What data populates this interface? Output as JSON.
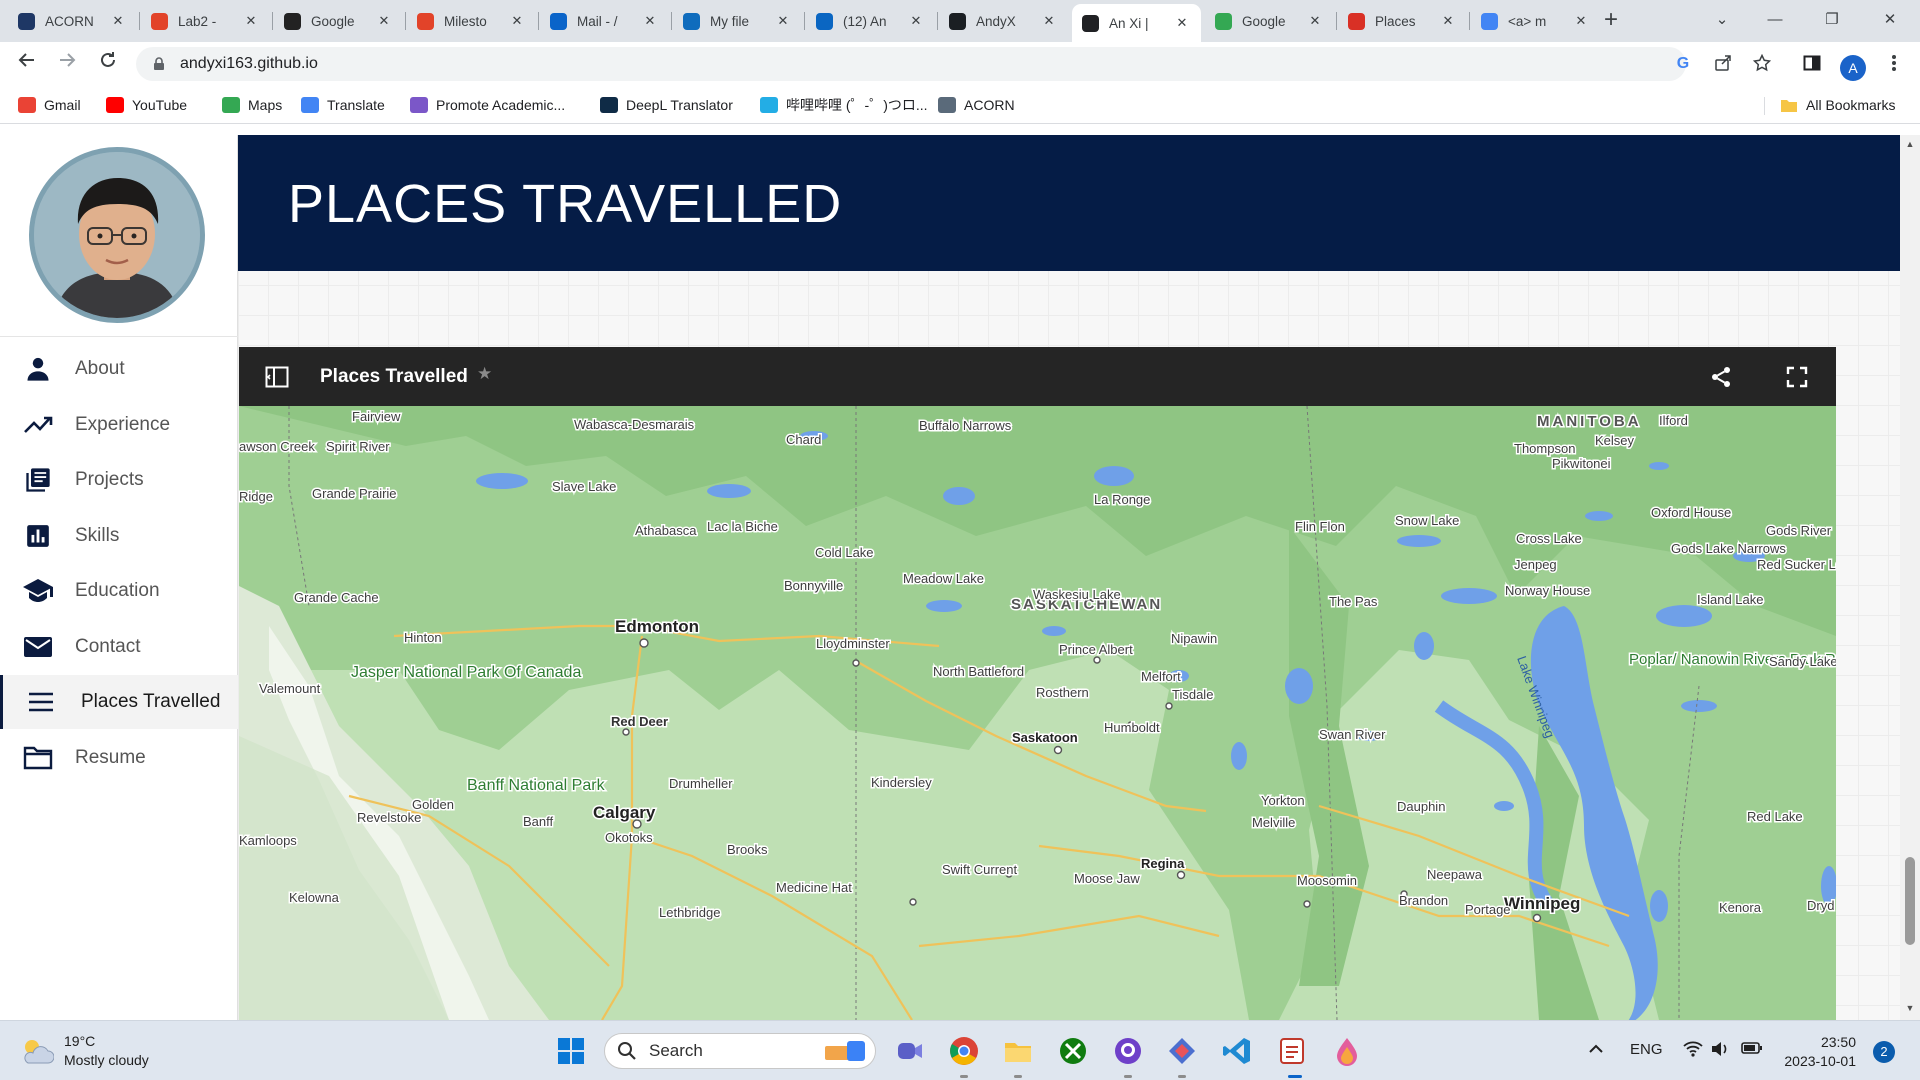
{
  "browser": {
    "tabs": [
      {
        "label": "ACORN",
        "icon": "acorn-icon",
        "color": "#1e3765"
      },
      {
        "label": "Lab2 -",
        "icon": "gitlab-icon",
        "color": "#e24329"
      },
      {
        "label": "Google",
        "icon": "google-meet-icon",
        "color": "#222222"
      },
      {
        "label": "Milesto",
        "icon": "gitlab-icon",
        "color": "#e24329"
      },
      {
        "label": "Mail - /",
        "icon": "outlook-icon",
        "color": "#0a64c9"
      },
      {
        "label": "My file",
        "icon": "onedrive-icon",
        "color": "#0f6cbd"
      },
      {
        "label": "(12) An",
        "icon": "linkedin-icon",
        "color": "#0a66c2"
      },
      {
        "label": "AndyX",
        "icon": "github-icon",
        "color": "#1b1f23"
      },
      {
        "label": "An Xi |",
        "icon": "code-icon",
        "color": "#202124"
      },
      {
        "label": "Google",
        "icon": "google-maps-icon",
        "color": "#34a853"
      },
      {
        "label": "Places",
        "icon": "places-icon",
        "color": "#d93025"
      },
      {
        "label": "<a> m",
        "icon": "google-icon",
        "color": "#4285f4"
      }
    ],
    "active_tab": 8,
    "url": "andyxi163.github.io",
    "profile_initial": "A",
    "bookmarks": [
      {
        "label": "Gmail",
        "color": "#ea4335"
      },
      {
        "label": "YouTube",
        "color": "#ff0000"
      },
      {
        "label": "Maps",
        "color": "#34a853"
      },
      {
        "label": "Translate",
        "color": "#4285f4"
      },
      {
        "label": "Promote Academic...",
        "color": "#7b57c8"
      },
      {
        "label": "DeepL Translator",
        "color": "#0f2b46"
      },
      {
        "label": "哔哩哔哩 (゜-゜)つロ...",
        "color": "#23ade5"
      },
      {
        "label": "ACORN",
        "color": "#5a6a7a"
      }
    ],
    "all_bookmarks": "All Bookmarks"
  },
  "sidebar": {
    "items": [
      {
        "label": "About",
        "icon": "person-icon"
      },
      {
        "label": "Experience",
        "icon": "trending-up-icon"
      },
      {
        "label": "Projects",
        "icon": "library-books-icon"
      },
      {
        "label": "Skills",
        "icon": "bar-chart-icon"
      },
      {
        "label": "Education",
        "icon": "school-icon"
      },
      {
        "label": "Contact",
        "icon": "mail-icon"
      },
      {
        "label": "Places Travelled",
        "icon": "menu-icon"
      },
      {
        "label": "Resume",
        "icon": "folder-icon"
      }
    ],
    "active_item": 6
  },
  "banner": {
    "title": "PLACES TRAVELLED"
  },
  "map": {
    "title": "Places Travelled",
    "labels": {
      "manitoba": "MANITOBA",
      "saskatchewan": "SASKATCHEWAN",
      "edmonton": "Edmonton",
      "calgary": "Calgary",
      "saskatoon": "Saskatoon",
      "regina": "Regina",
      "winnipeg": "Winnipeg",
      "fairview": "Fairview",
      "dawson_creek": "awson Creek",
      "spirit_river": "Spirit River",
      "wabasca": "Wabasca-Desmarais",
      "chard": "Chard",
      "buffalo_narrows": "Buffalo Narrows",
      "thompson": "Thompson",
      "kelsey": "Kelsey",
      "ilford": "Ilford",
      "pikwitonei": "Pikwitonei",
      "ridge": "Ridge",
      "grande_prairie": "Grande Prairie",
      "slave_lake": "Slave Lake",
      "la_ronge": "La Ronge",
      "oxford_house": "Oxford House",
      "athabasca": "Athabasca",
      "lac_la_biche": "Lac la Biche",
      "flin_flon": "Flin Flon",
      "snow_lake": "Snow Lake",
      "gods_river": "Gods River",
      "cold_lake": "Cold Lake",
      "cross_lake": "Cross Lake",
      "gods_lake_narrows": "Gods Lake Narrows",
      "jenpeg": "Jenpeg",
      "red_sucker_lake": "Red Sucker Lake",
      "meadow_lake": "Meadow Lake",
      "bonnyville": "Bonnyville",
      "norway_house": "Norway House",
      "waskesiu_lake": "Waskesiu Lake",
      "grande_cache": "Grande Cache",
      "the_pas": "The Pas",
      "island_lake": "Island Lake",
      "hinton": "Hinton",
      "nipawin": "Nipawin",
      "lloydminster": "Lloydminster",
      "lake_winnipeg": "Lake Winnipeg",
      "prince_albert": "Prince Albert",
      "poplar_nanowin": "Poplar/ Nanowin Rivers Park Reserve",
      "sandy_lake": "Sandy Lake",
      "north_battleford": "North Battleford",
      "melfort": "Melfort",
      "valemount": "Valemount",
      "jasper": "Jasper National Park Of Canada",
      "tisdale": "Tisdale",
      "rosthern": "Rosthern",
      "red_deer": "Red Deer",
      "humboldt": "Humboldt",
      "swan_river": "Swan River",
      "drumheller": "Drumheller",
      "kindersley": "Kindersley",
      "banff_np": "Banff National Park",
      "yorkton": "Yorkton",
      "dauphin": "Dauphin",
      "golden": "Golden",
      "revelstoke": "Revelstoke",
      "banff": "Banff",
      "melville": "Melville",
      "red_lake": "Red Lake",
      "kamloops": "Kamloops",
      "okotoks": "Okotoks",
      "brooks": "Brooks",
      "swift_current": "Swift Current",
      "moose_jaw": "Moose Jaw",
      "moosomin": "Moosomin",
      "neepawa": "Neepawa",
      "medicine_hat": "Medicine Hat",
      "kelowna": "Kelowna",
      "lethbridge": "Lethbridge",
      "brandon": "Brandon",
      "portage": "Portage",
      "kenora": "Kenora",
      "dryd": "Dryd"
    }
  },
  "taskbar": {
    "weather_temp": "19°C",
    "weather_desc": "Mostly cloudy",
    "search_label": "Search",
    "language": "ENG",
    "time": "23:50",
    "date": "2023-10-01",
    "notifications": "2"
  }
}
